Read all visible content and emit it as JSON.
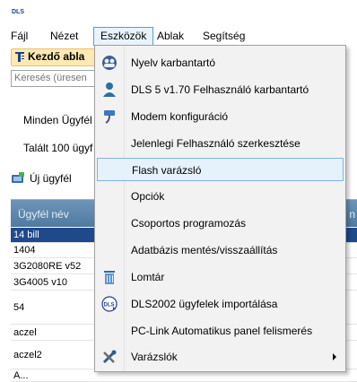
{
  "app": {
    "logo_text": "DLS"
  },
  "menubar": {
    "items": [
      {
        "label": "Fájl"
      },
      {
        "label": "Nézet"
      },
      {
        "label": "Eszközök"
      },
      {
        "label": "Ablak"
      },
      {
        "label": "Segítség"
      }
    ]
  },
  "tab": {
    "label": "Kezdő abla"
  },
  "search": {
    "placeholder": "Keresés (üresen"
  },
  "filter_label": "Minden Ügyfél",
  "found_label": "Talált 100 ügyf",
  "new_client": {
    "label": "Új ügyfél"
  },
  "grid": {
    "header": "Ügyfél név",
    "header_right": "t n",
    "rows": [
      "14 bill",
      "1404",
      "3G2080RE v52",
      "3G4005 v10",
      "54",
      "aczel",
      "aczel2",
      "A..."
    ]
  },
  "tools_menu": {
    "items": [
      {
        "label": "Nyelv karbantartó",
        "icon": "people-icon"
      },
      {
        "label": "DLS 5 v1.70 Felhasználó karbantartó",
        "icon": "user-icon"
      },
      {
        "label": "Modem konfiguráció",
        "icon": "modem-plug-icon"
      },
      {
        "label": "Jelenlegi Felhasználó szerkesztése",
        "icon": ""
      },
      {
        "label": "Flash varázsló",
        "icon": ""
      },
      {
        "label": "Opciók",
        "icon": ""
      },
      {
        "label": "Csoportos programozás",
        "icon": ""
      },
      {
        "label": "Adatbázis mentés/visszaállítás",
        "icon": ""
      },
      {
        "label": "Lomtár",
        "icon": "trash-icon"
      },
      {
        "label": "DLS2002 ügyfelek importálása",
        "icon": "dls-import-icon"
      },
      {
        "label": "PC-Link Automatikus panel felismerés",
        "icon": ""
      },
      {
        "label": "Varázslók",
        "icon": "tools-icon"
      }
    ]
  },
  "colors": {
    "accent": "#5b9bd5",
    "highlight": "#e5f1fb",
    "selected_row": "#1f4a8a",
    "grid_header": "#5a84aa"
  }
}
